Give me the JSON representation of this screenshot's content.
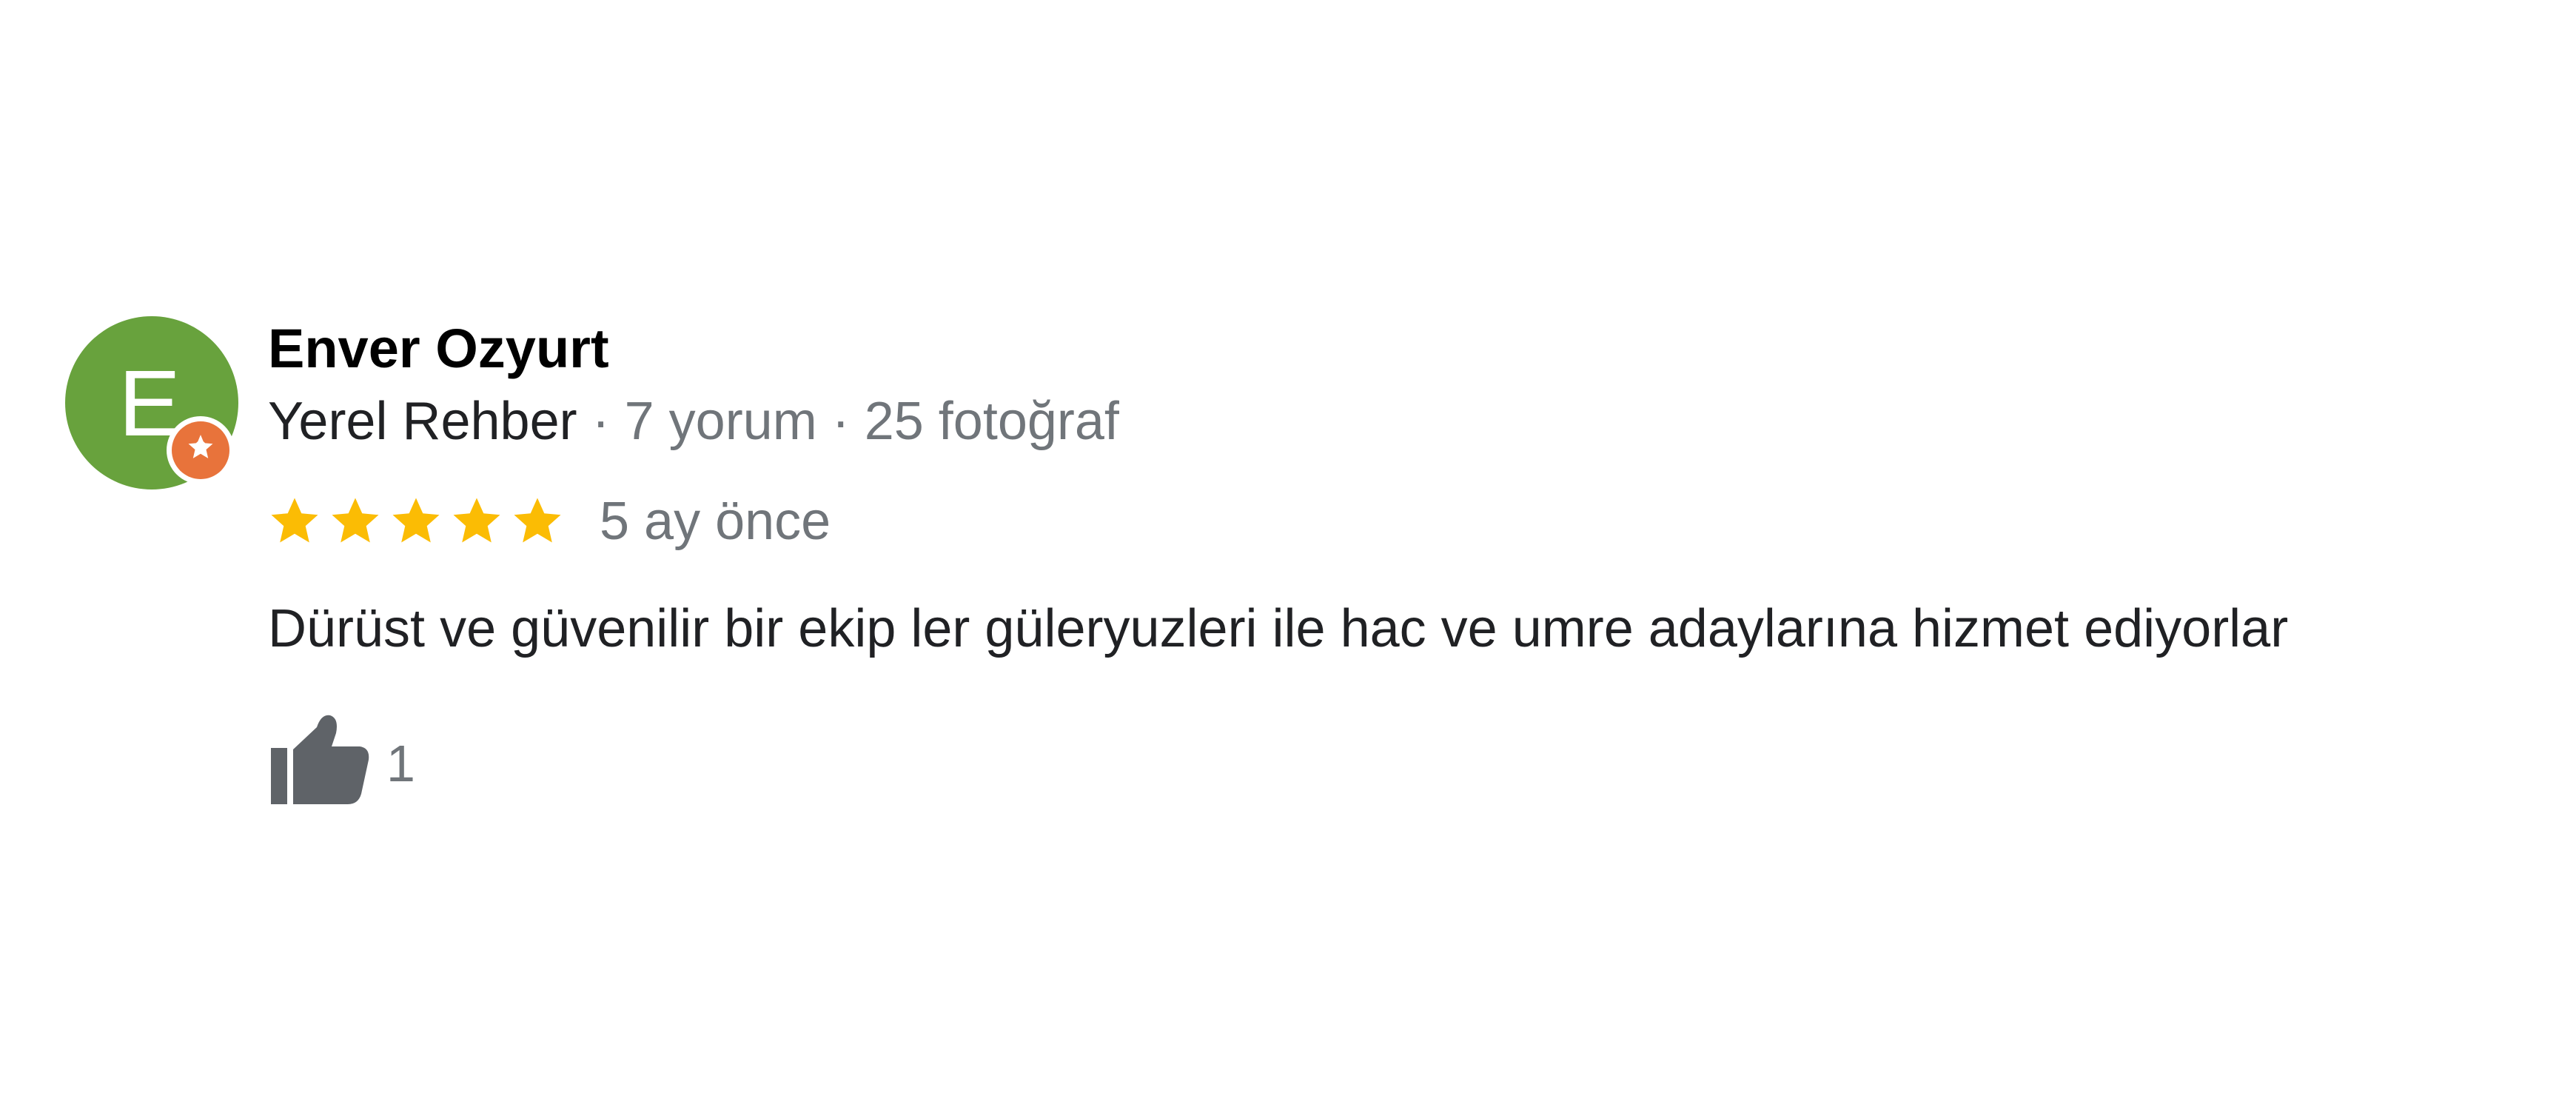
{
  "review": {
    "author": {
      "initial": "E",
      "avatar_color": "#68a23d",
      "badge_icon": "local-guide-badge-icon",
      "badge_color": "#e8733b",
      "name": "Enver Ozyurt",
      "level": "Yerel Rehber",
      "separator_1": " · ",
      "review_count": "7 yorum",
      "separator_2": " · ",
      "photo_count": "25 fotoğraf"
    },
    "rating": {
      "stars": 5,
      "max_stars": 5,
      "star_icon": "star-icon",
      "star_color": "#fbbc04"
    },
    "date": "5 ay önce",
    "text": "Dürüst ve güvenilir bir ekip ler güleryuzleri ile hac ve umre adaylarına hizmet ediyorlar",
    "like": {
      "icon": "thumbs-up-icon",
      "count": "1",
      "icon_color": "#5f6368"
    }
  }
}
